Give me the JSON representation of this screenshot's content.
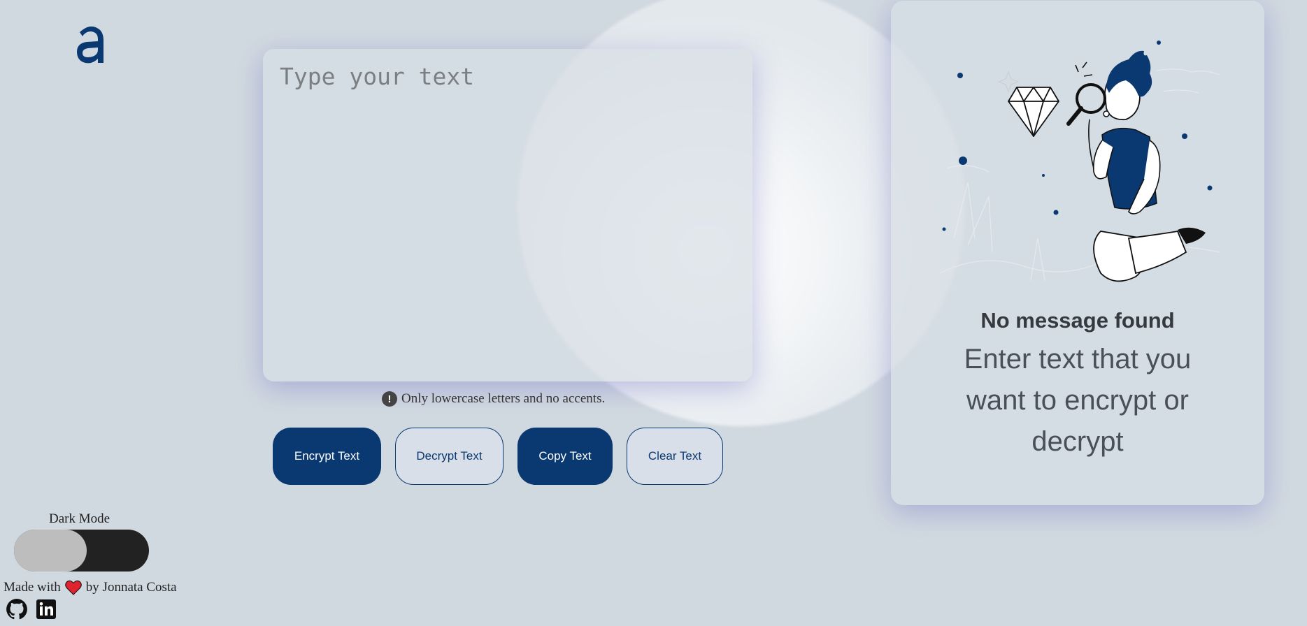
{
  "logo": {
    "alt_letter": "a"
  },
  "input": {
    "placeholder": "Type your text"
  },
  "hint": {
    "icon": "exclamation-icon",
    "text": "Only lowercase letters and no accents."
  },
  "buttons": {
    "encrypt": "Encrypt Text",
    "decrypt": "Decrypt Text",
    "copy": "Copy Text",
    "clear": "Clear Text"
  },
  "output": {
    "title": "No message found",
    "description": "Enter text that you want to encrypt or decrypt"
  },
  "settings": {
    "dark_mode_label": "Dark Mode",
    "dark_mode_on": false
  },
  "footer": {
    "made_with": "Made with",
    "by": "by Jonnata Costa",
    "social_icons": [
      "github-icon",
      "linkedin-icon"
    ]
  },
  "colors": {
    "background": "#d1d9e0",
    "primary": "#0a3871",
    "heart": "#e0232e"
  }
}
